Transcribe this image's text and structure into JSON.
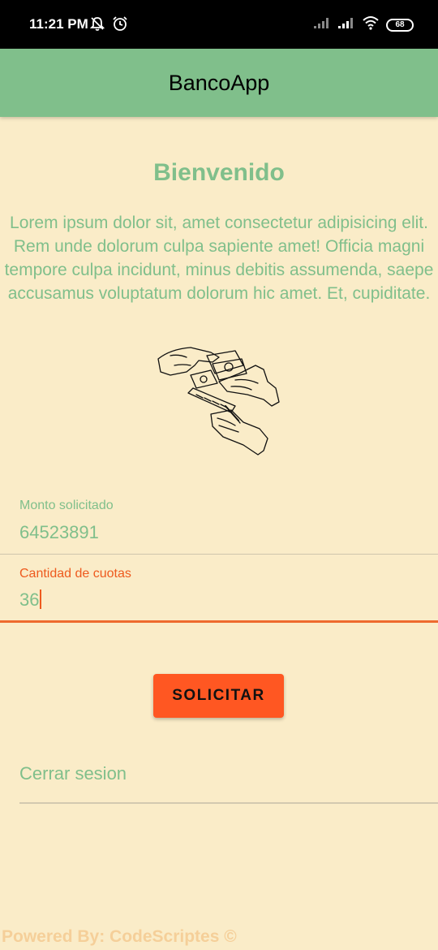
{
  "status_bar": {
    "time": "11:21 PM",
    "battery": "68",
    "icons": [
      "mute-notifications-icon",
      "alarm-icon",
      "signal-icon",
      "signal-icon",
      "wifi-icon",
      "battery-icon"
    ]
  },
  "app_bar": {
    "title": "BancoApp"
  },
  "main": {
    "heading": "Bienvenido",
    "description": "Lorem ipsum dolor sit, amet consectetur adipisicing elit. Rem unde dolorum culpa sapiente amet! Officia magni tempore culpa incidunt, minus debitis assumenda, saepe accusamus voluptatum dolorum hic amet. Et, cupiditate.",
    "illustration": "hands-exchanging-money-illustration"
  },
  "form": {
    "amount": {
      "label": "Monto solicitado",
      "value": "64523891"
    },
    "installments": {
      "label": "Cantidad de cuotas",
      "value": "36"
    },
    "submit_label": "SOLICITAR"
  },
  "logout_label": "Cerrar sesion",
  "footer": "Powered By: CodeScriptes ©",
  "colors": {
    "primary": "#80bf8b",
    "background": "#faecc8",
    "accent": "#ff5722",
    "focus": "#ee5a1e",
    "footer": "#f5cf99"
  }
}
